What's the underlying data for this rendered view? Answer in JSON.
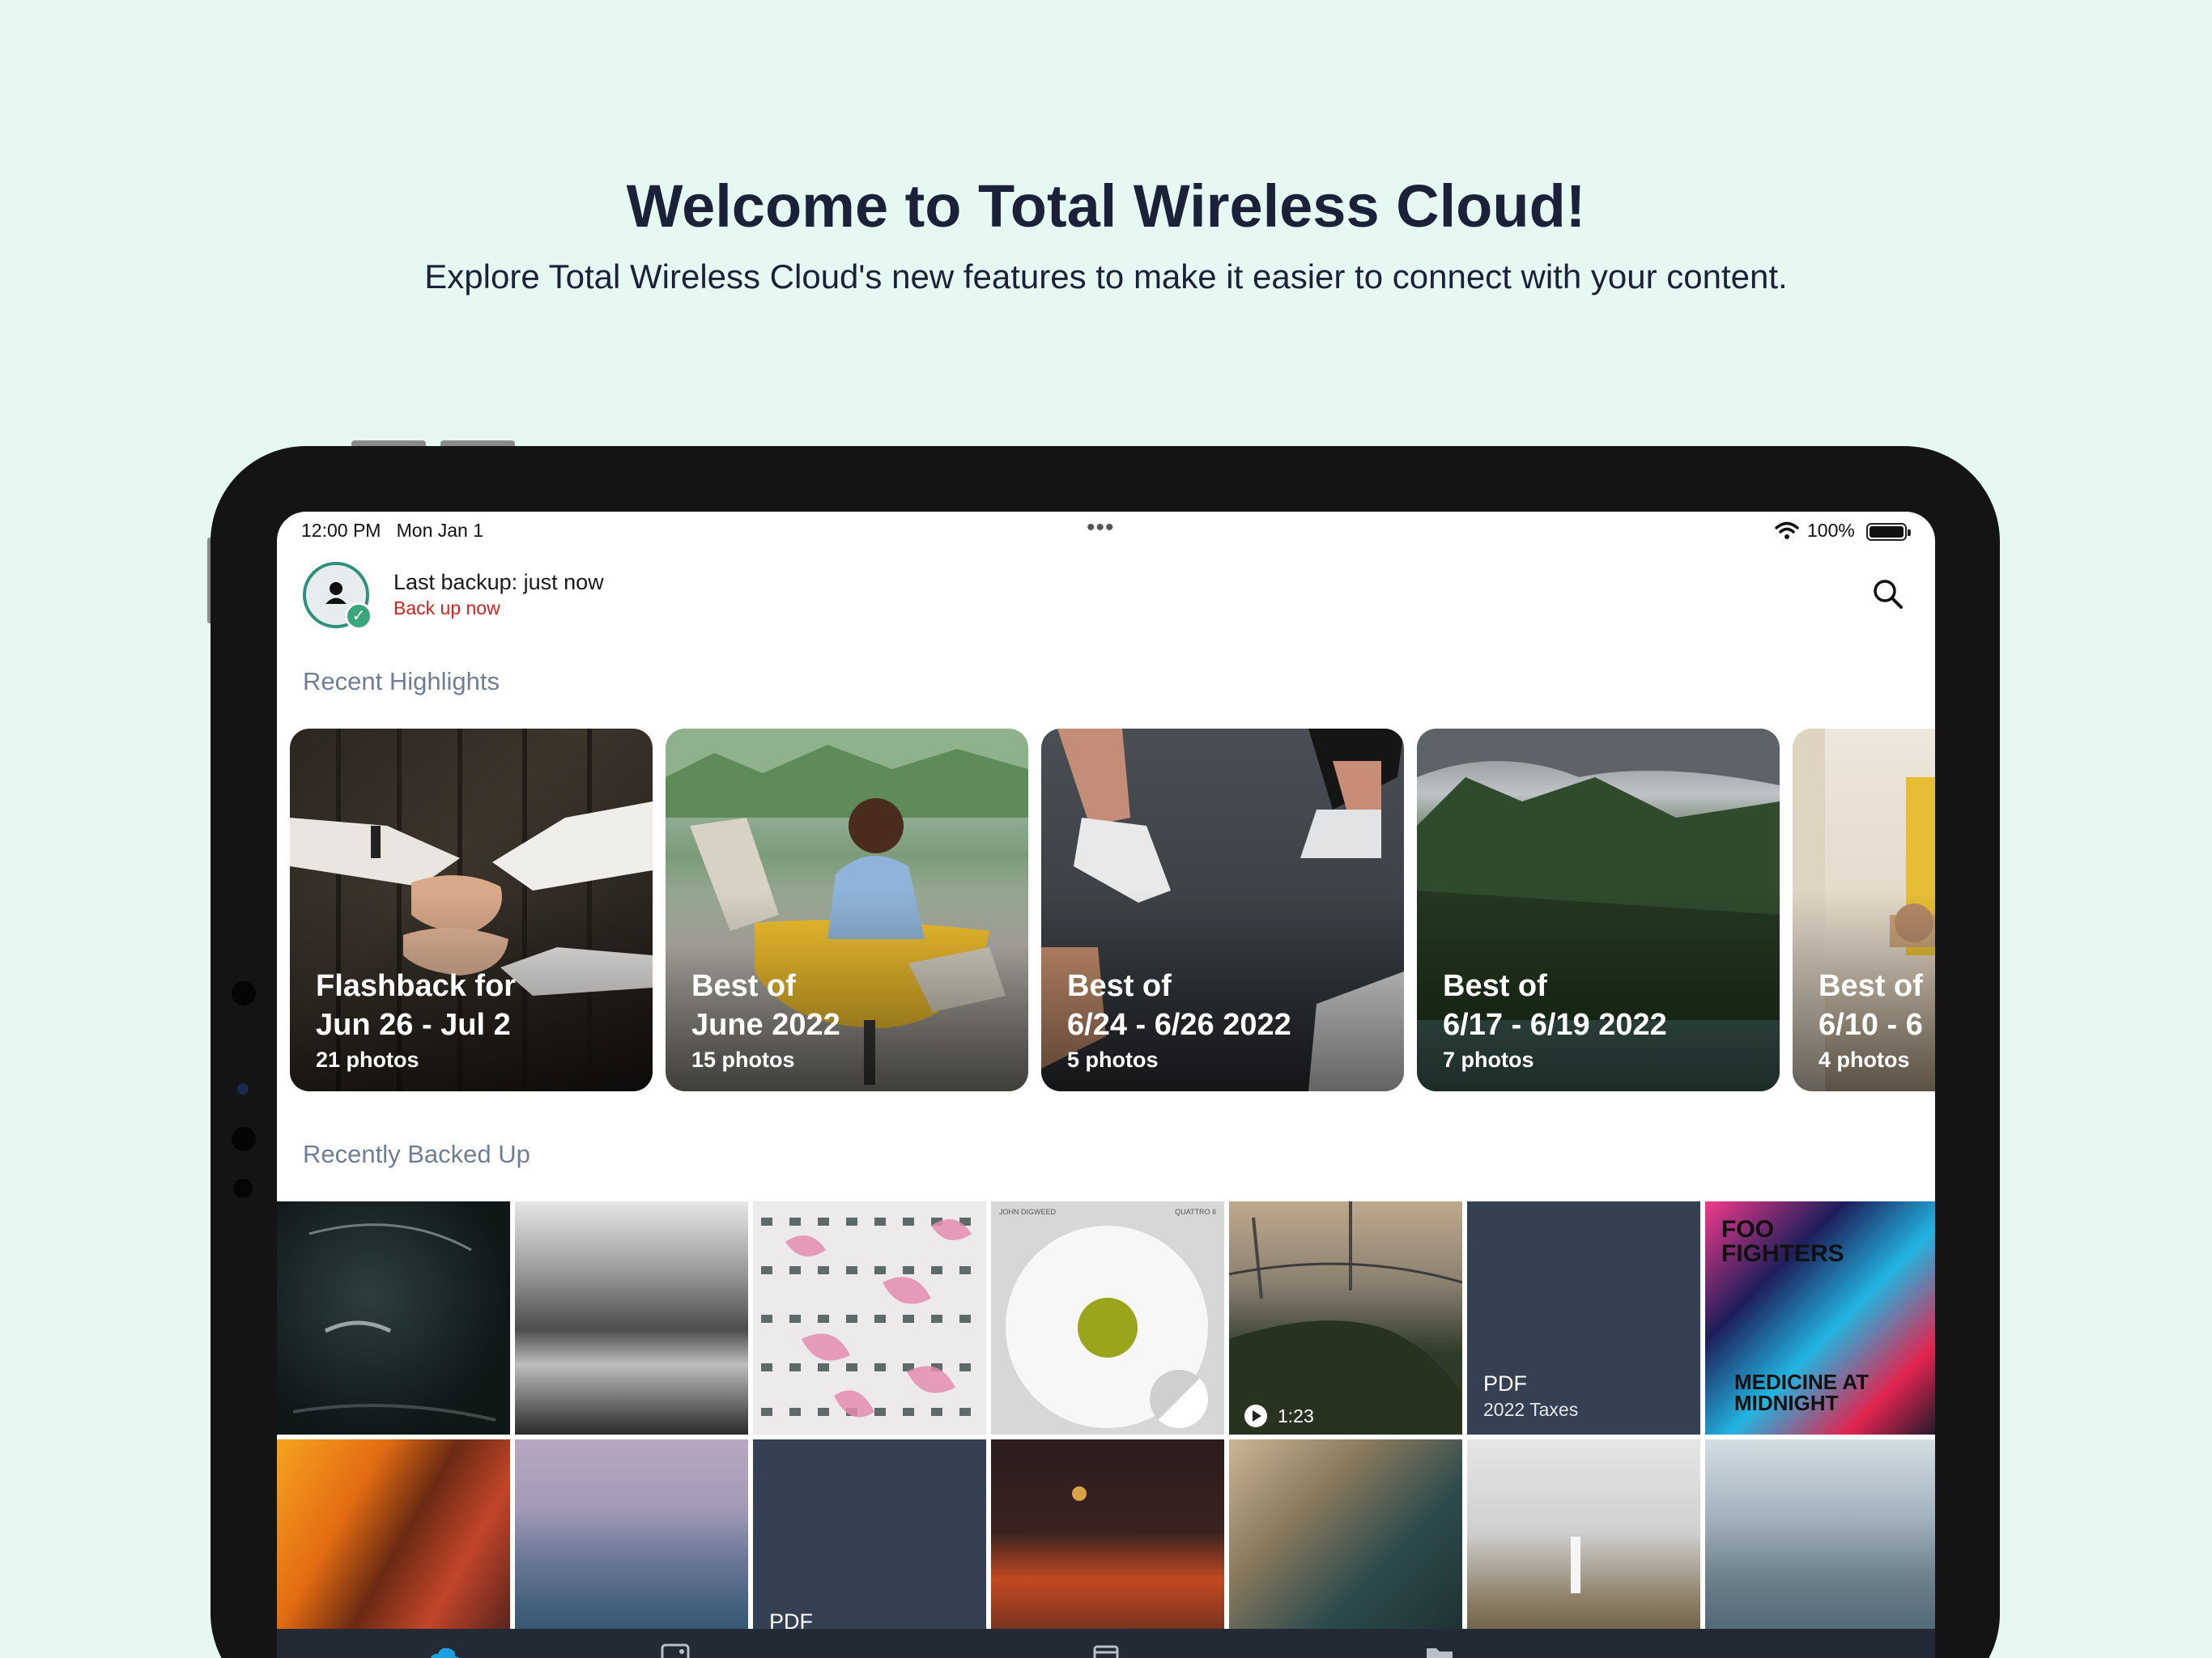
{
  "promo": {
    "headline": "Welcome to Total Wireless Cloud!",
    "subhead": "Explore Total Wireless Cloud's new features to make it easier to connect with your content."
  },
  "status_bar": {
    "time": "12:00 PM",
    "date": "Mon Jan 1",
    "battery": "100%"
  },
  "header": {
    "backup_title": "Last backup: just now",
    "backup_link": "Back up now"
  },
  "sections": {
    "highlights_title": "Recent Highlights",
    "backed_up_title": "Recently Backed Up"
  },
  "highlights": [
    {
      "title": "Flashback for",
      "subtitle": "Jun 26 - Jul 2",
      "count": "21 photos"
    },
    {
      "title": "Best of",
      "subtitle": "June 2022",
      "count": "15 photos"
    },
    {
      "title": "Best of",
      "subtitle": "6/24 - 6/26 2022",
      "count": "5 photos"
    },
    {
      "title": "Best of",
      "subtitle": "6/17 - 6/19 2022",
      "count": "7 photos"
    },
    {
      "title": "Best of",
      "subtitle": "6/10 - 6",
      "count": "4 photos"
    }
  ],
  "grid": {
    "video_duration": "1:23",
    "pdf_label": "PDF",
    "pdf_name": "2022 Taxes",
    "pdf_label_2": "PDF",
    "album_artist": "JOHN DIGWEED",
    "album_title": "QUATTRO II",
    "poster_line1": "FOO FIGHTERS",
    "poster_line2": "MEDICINE AT MIDNIGHT"
  },
  "icons": {
    "search": "search-icon",
    "wifi": "wifi-icon",
    "battery": "battery-icon",
    "avatar": "person-icon",
    "badge": "check-icon",
    "play": "play-icon",
    "nav": [
      "cloud-icon",
      "photos-icon",
      "calendar-icon",
      "folder-icon",
      "more-icon"
    ]
  },
  "colors": {
    "background": "#e5f9f2",
    "headline": "#1b2138",
    "link": "#d52020",
    "section_title": "#6f7e96",
    "accent": "#3aa67b",
    "pdf_tile": "#354052",
    "navbar": "#232a35"
  }
}
